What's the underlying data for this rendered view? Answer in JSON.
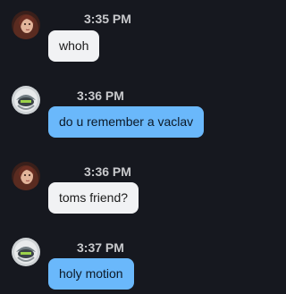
{
  "messages": [
    {
      "avatar": "female-portrait-avatar",
      "time": "3:35 PM",
      "text": "whoh",
      "side": "in"
    },
    {
      "avatar": "robot-helmet-avatar",
      "time": "3:36 PM",
      "text": "do u remember a vaclav",
      "side": "out"
    },
    {
      "avatar": "female-portrait-avatar",
      "time": "3:36 PM",
      "text": "toms friend?",
      "side": "in"
    },
    {
      "avatar": "robot-helmet-avatar",
      "time": "3:37 PM",
      "text": "holy motion",
      "side": "out"
    }
  ],
  "colors": {
    "background": "#16181f",
    "incoming_bubble": "#f1f2f4",
    "outgoing_bubble": "#6ab8fb",
    "timestamp": "#c8c9cc"
  }
}
